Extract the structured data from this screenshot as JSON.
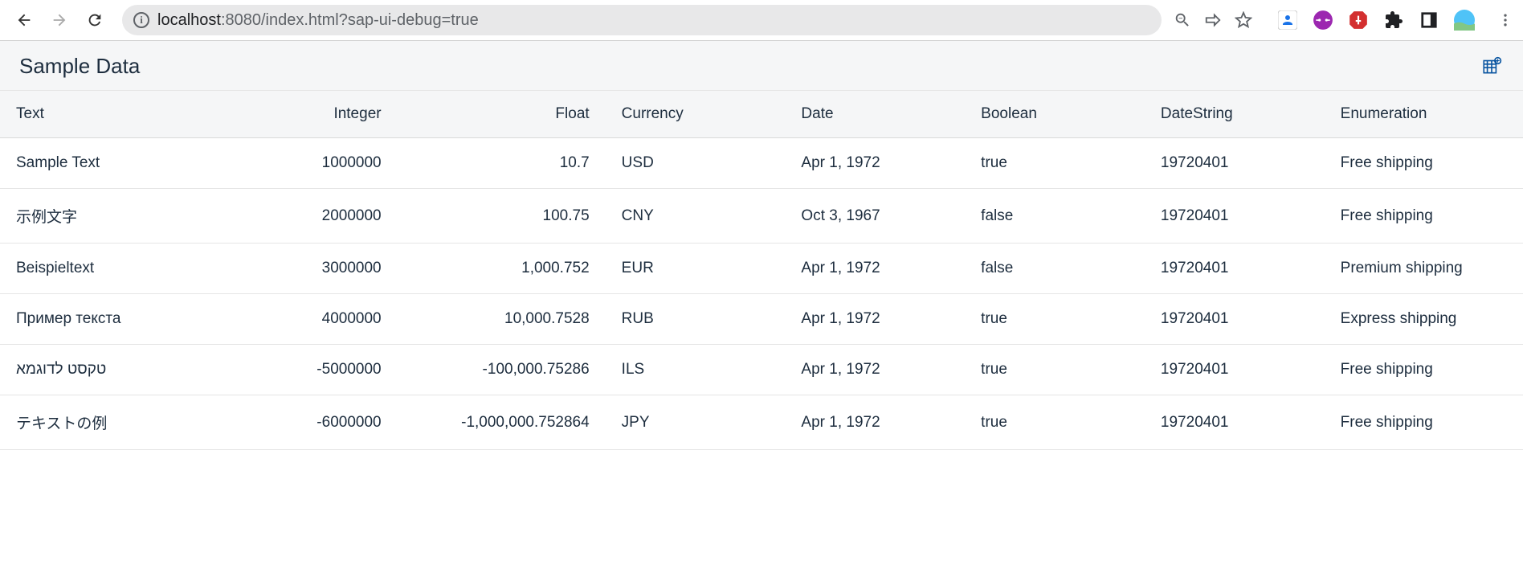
{
  "browser": {
    "url_host": "localhost",
    "url_port": ":8080",
    "url_path": "/index.html?sap-ui-debug=true"
  },
  "page": {
    "title": "Sample Data"
  },
  "table": {
    "headers": {
      "text": "Text",
      "integer": "Integer",
      "float": "Float",
      "currency": "Currency",
      "date": "Date",
      "boolean": "Boolean",
      "datestring": "DateString",
      "enumeration": "Enumeration"
    },
    "rows": [
      {
        "text": "Sample Text",
        "integer": "1000000",
        "float": "10.7",
        "currency": "USD",
        "date": "Apr 1, 1972",
        "boolean": "true",
        "datestring": "19720401",
        "enumeration": "Free shipping"
      },
      {
        "text": "示例文字",
        "integer": "2000000",
        "float": "100.75",
        "currency": "CNY",
        "date": "Oct 3, 1967",
        "boolean": "false",
        "datestring": "19720401",
        "enumeration": "Free shipping"
      },
      {
        "text": "Beispieltext",
        "integer": "3000000",
        "float": "1,000.752",
        "currency": "EUR",
        "date": "Apr 1, 1972",
        "boolean": "false",
        "datestring": "19720401",
        "enumeration": "Premium shipping"
      },
      {
        "text": "Пример текста",
        "integer": "4000000",
        "float": "10,000.7528",
        "currency": "RUB",
        "date": "Apr 1, 1972",
        "boolean": "true",
        "datestring": "19720401",
        "enumeration": "Express shipping"
      },
      {
        "text": "טקסט לדוגמא",
        "integer": "-5000000",
        "float": "-100,000.75286",
        "currency": "ILS",
        "date": "Apr 1, 1972",
        "boolean": "true",
        "datestring": "19720401",
        "enumeration": "Free shipping"
      },
      {
        "text": "テキストの例",
        "integer": "-6000000",
        "float": "-1,000,000.752864",
        "currency": "JPY",
        "date": "Apr 1, 1972",
        "boolean": "true",
        "datestring": "19720401",
        "enumeration": "Free shipping"
      }
    ]
  }
}
